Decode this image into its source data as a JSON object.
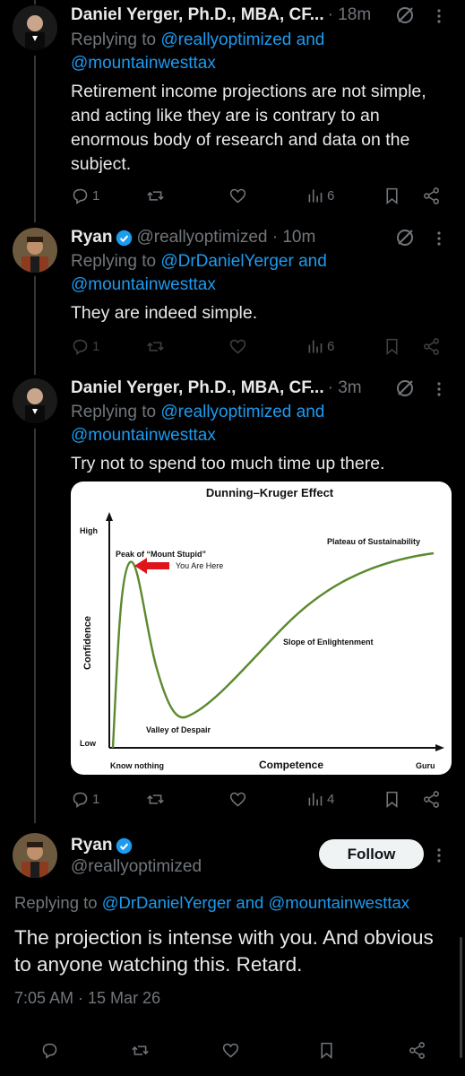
{
  "colors": {
    "background": "#000000",
    "text": "#e7e9ea",
    "muted": "#71767b",
    "link": "#1d9bf0",
    "verified": "#1d9bf0",
    "curve": "#5a8a2e",
    "arrow": "#e0151b"
  },
  "tweets": [
    {
      "name": "Daniel Yerger, Ph.D., MBA, CF...",
      "meta": "· 18m",
      "reply_prefix": "Replying to ",
      "reply_handle1": "@reallyoptimized",
      "reply_and": " and",
      "reply_handle2": "@mountainwesttax",
      "text": "Retirement income projections are not simple, and acting like they are is contrary to an enormous body of research and data on the subject.",
      "replies": "1",
      "views": "6"
    },
    {
      "name": "Ryan",
      "meta": "@reallyoptimized · 10m",
      "reply_prefix": "Replying to ",
      "reply_handle1": "@DrDanielYerger",
      "reply_and": " and",
      "reply_handle2": "@mountainwesttax",
      "text": "They are indeed simple.",
      "replies": "1",
      "views": "6"
    },
    {
      "name": "Daniel Yerger, Ph.D., MBA, CF...",
      "meta": "· 3m",
      "reply_prefix": "Replying to ",
      "reply_handle1": "@reallyoptimized",
      "reply_and": " and",
      "reply_handle2": "@mountainwesttax",
      "text": "Try not to spend too much time up there.",
      "replies": "1",
      "views": "4"
    }
  ],
  "chart_data": {
    "type": "line",
    "title": "Dunning–Kruger Effect",
    "xlabel": "Competence",
    "ylabel": "Confidence",
    "x_ticks": [
      "Know nothing",
      "Guru"
    ],
    "y_ticks": [
      "High",
      "Low"
    ],
    "annotations": [
      "Peak of “Mount Stupid”",
      "You Are Here",
      "Valley of Despair",
      "Slope of Enlightenment",
      "Plateau of Sustainability"
    ],
    "series": [
      {
        "x": [
          0,
          1,
          2,
          3,
          4,
          5,
          6,
          7,
          8,
          10
        ],
        "values": [
          0,
          90,
          55,
          20,
          22,
          38,
          55,
          72,
          85,
          92
        ]
      }
    ]
  },
  "focus_tweet": {
    "name": "Ryan",
    "handle": "@reallyoptimized",
    "follow_label": "Follow",
    "reply_prefix": "Replying to ",
    "reply_handle1": "@DrDanielYerger",
    "reply_and": " and ",
    "reply_handle2": "@mountainwesttax",
    "text": "The projection is intense with you. And obvious to anyone watching this. Retard.",
    "timestamp": "7:05 AM · 15 Mar 26"
  }
}
